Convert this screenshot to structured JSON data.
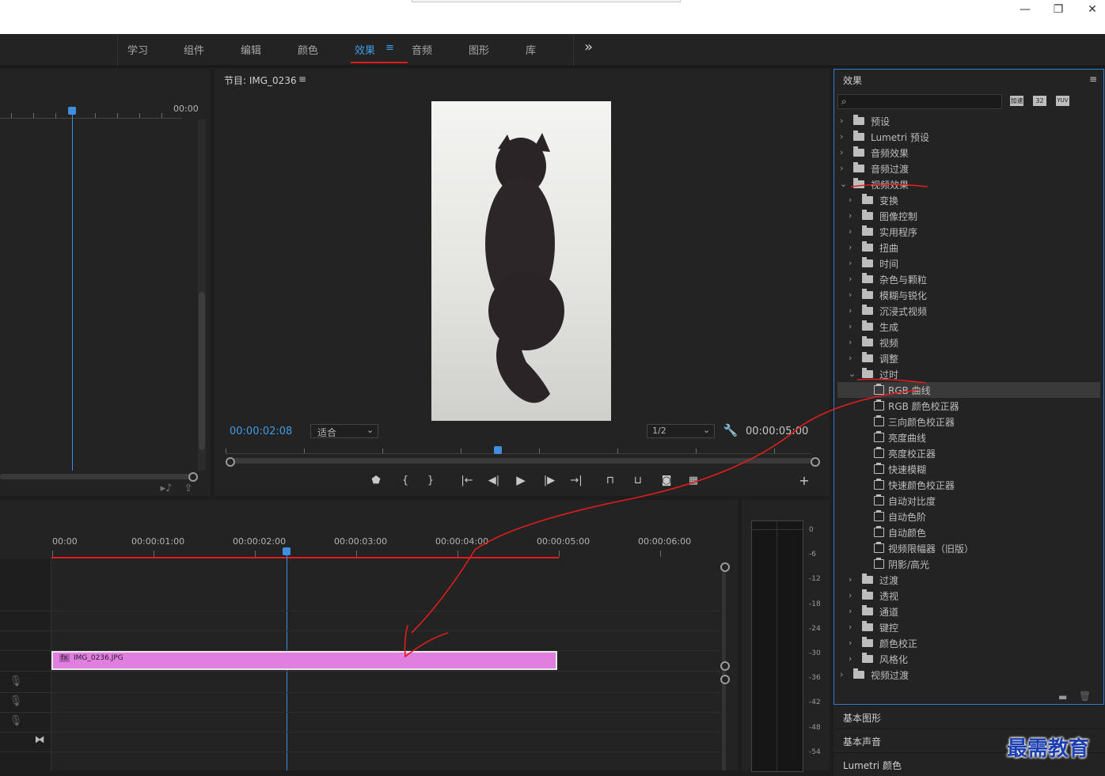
{
  "titlebar": {
    "minimize": "—",
    "restore": "❐",
    "close": "✕"
  },
  "workspaces": {
    "tabs": [
      {
        "label": "学习"
      },
      {
        "label": "组件"
      },
      {
        "label": "编辑"
      },
      {
        "label": "颜色"
      },
      {
        "label": "效果"
      },
      {
        "label": "音频"
      },
      {
        "label": "图形"
      },
      {
        "label": "库"
      }
    ],
    "active_menu": "≡",
    "overflow": "»"
  },
  "source_panel": {
    "timecode": "00:00"
  },
  "program": {
    "title": "节目: IMG_0236",
    "menu": "≡",
    "timecode": "00:00:02:08",
    "fit_label": "适合",
    "resolution": "1/2",
    "duration": "00:00:05:00",
    "add_button": "+"
  },
  "timeline": {
    "ruler": [
      "00:00",
      "00:00:01:00",
      "00:00:02:00",
      "00:00:03:00",
      "00:00:04:00",
      "00:00:05:00",
      "00:00:06:00"
    ],
    "clip_label": "IMG_0236.JPG",
    "clip_fx": "fx"
  },
  "meter": {
    "labels": [
      "0",
      "-6",
      "-12",
      "-18",
      "-24",
      "-30",
      "-36",
      "-42",
      "-48",
      "-54"
    ]
  },
  "effects": {
    "title": "效果",
    "menu": "≡",
    "search_placeholder": "",
    "filter_icons": [
      "加速",
      "32",
      "YUV"
    ],
    "tree": [
      {
        "label": "预设",
        "level": 0,
        "open": false,
        "kind": "folder"
      },
      {
        "label": "Lumetri 预设",
        "level": 0,
        "open": false,
        "kind": "folder"
      },
      {
        "label": "音频效果",
        "level": 0,
        "open": false,
        "kind": "folder"
      },
      {
        "label": "音频过渡",
        "level": 0,
        "open": false,
        "kind": "folder"
      },
      {
        "label": "视频效果",
        "level": 0,
        "open": true,
        "kind": "folder"
      },
      {
        "label": "变换",
        "level": 1,
        "open": false,
        "kind": "folder"
      },
      {
        "label": "图像控制",
        "level": 1,
        "open": false,
        "kind": "folder"
      },
      {
        "label": "实用程序",
        "level": 1,
        "open": false,
        "kind": "folder"
      },
      {
        "label": "扭曲",
        "level": 1,
        "open": false,
        "kind": "folder"
      },
      {
        "label": "时间",
        "level": 1,
        "open": false,
        "kind": "folder"
      },
      {
        "label": "杂色与颗粒",
        "level": 1,
        "open": false,
        "kind": "folder"
      },
      {
        "label": "模糊与锐化",
        "level": 1,
        "open": false,
        "kind": "folder"
      },
      {
        "label": "沉浸式视频",
        "level": 1,
        "open": false,
        "kind": "folder"
      },
      {
        "label": "生成",
        "level": 1,
        "open": false,
        "kind": "folder"
      },
      {
        "label": "视频",
        "level": 1,
        "open": false,
        "kind": "folder"
      },
      {
        "label": "调整",
        "level": 1,
        "open": false,
        "kind": "folder"
      },
      {
        "label": "过时",
        "level": 1,
        "open": true,
        "kind": "folder"
      },
      {
        "label": "RGB 曲线",
        "level": 2,
        "kind": "effect",
        "selected": true
      },
      {
        "label": "RGB 颜色校正器",
        "level": 2,
        "kind": "effect"
      },
      {
        "label": "三向颜色校正器",
        "level": 2,
        "kind": "effect"
      },
      {
        "label": "亮度曲线",
        "level": 2,
        "kind": "effect"
      },
      {
        "label": "亮度校正器",
        "level": 2,
        "kind": "effect"
      },
      {
        "label": "快速模糊",
        "level": 2,
        "kind": "effect"
      },
      {
        "label": "快速颜色校正器",
        "level": 2,
        "kind": "effect"
      },
      {
        "label": "自动对比度",
        "level": 2,
        "kind": "effect"
      },
      {
        "label": "自动色阶",
        "level": 2,
        "kind": "effect"
      },
      {
        "label": "自动颜色",
        "level": 2,
        "kind": "effect"
      },
      {
        "label": "视频限幅器（旧版）",
        "level": 2,
        "kind": "effect"
      },
      {
        "label": "阴影/高光",
        "level": 2,
        "kind": "effect"
      },
      {
        "label": "过渡",
        "level": 1,
        "open": false,
        "kind": "folder"
      },
      {
        "label": "透视",
        "level": 1,
        "open": false,
        "kind": "folder"
      },
      {
        "label": "通道",
        "level": 1,
        "open": false,
        "kind": "folder"
      },
      {
        "label": "键控",
        "level": 1,
        "open": false,
        "kind": "folder"
      },
      {
        "label": "颜色校正",
        "level": 1,
        "open": false,
        "kind": "folder"
      },
      {
        "label": "风格化",
        "level": 1,
        "open": false,
        "kind": "folder"
      },
      {
        "label": "视频过渡",
        "level": 0,
        "open": false,
        "kind": "folder"
      }
    ]
  },
  "side_panels": [
    "基本图形",
    "基本声音",
    "Lumetri 颜色"
  ],
  "watermark": "最需教育",
  "colors": {
    "accent": "#3f9de8",
    "annotation": "#e01d1d",
    "clip": "#e07fe0"
  }
}
